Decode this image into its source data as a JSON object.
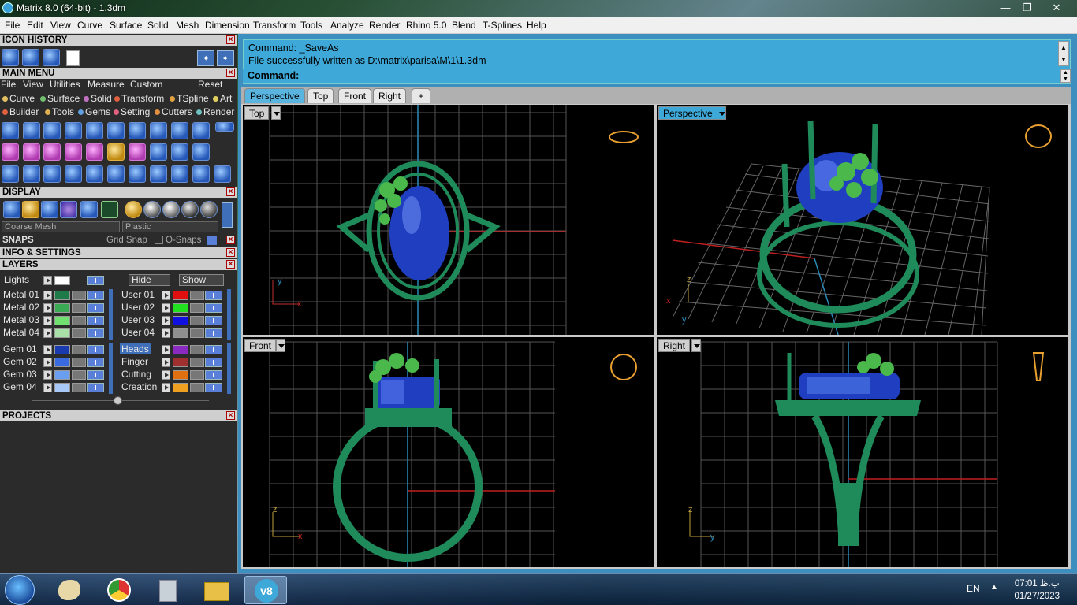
{
  "window": {
    "title": "Matrix 8.0 (64-bit) - 1.3dm"
  },
  "menubar": [
    "File",
    "Edit",
    "View",
    "Curve",
    "Surface",
    "Solid",
    "Mesh",
    "Dimension",
    "Transform",
    "Tools",
    "Analyze",
    "Render",
    "Rhino 5.0",
    "Blend",
    "T-Splines",
    "Help"
  ],
  "leftpanel": {
    "icon_history": "ICON HISTORY",
    "main_menu": "MAIN MENU",
    "main_menu_items": [
      "File",
      "View",
      "Utilities",
      "Measure",
      "Custom"
    ],
    "reset": "Reset",
    "categories_row1": [
      "Curve",
      "Surface",
      "Solid",
      "Transform",
      "TSpline",
      "Art"
    ],
    "categories_row2": [
      "Builder",
      "Tools",
      "Gems",
      "Setting",
      "Cutters",
      "Render"
    ],
    "display": "DISPLAY",
    "mesh_mode": "Coarse Mesh",
    "material_mode": "Plastic",
    "snaps": "SNAPS",
    "grid_snap": "Grid Snap",
    "osnaps": "O-Snaps",
    "info_settings": "INFO & SETTINGS",
    "layers": "LAYERS",
    "lights": "Lights",
    "hide": "Hide",
    "show": "Show",
    "layers_left": [
      "Metal 01",
      "Metal 02",
      "Metal 03",
      "Metal 04",
      "Gem 01",
      "Gem 02",
      "Gem 03",
      "Gem 04"
    ],
    "layers_right": [
      "User 01",
      "User 02",
      "User 03",
      "User 04",
      "Heads",
      "Finger",
      "Cutting",
      "Creation"
    ],
    "projects": "PROJECTS"
  },
  "command": {
    "line1": "Command: _SaveAs",
    "line2": "File successfully written as D:\\matrix\\parisa\\M\\1\\1.3dm",
    "prompt": "Command:"
  },
  "tabs": [
    "Perspective",
    "Top",
    "Front",
    "Right"
  ],
  "viewports": {
    "top": "Top",
    "perspective": "Perspective",
    "front": "Front",
    "right": "Right"
  },
  "axes": {
    "x": "x",
    "y": "y",
    "z": "z"
  },
  "taskbar": {
    "lang": "EN",
    "time": "07:01 ب.ظ",
    "date": "01/27/2023"
  },
  "colors": {
    "accent": "#3ea9d8",
    "ring_green": "#2f9a6a",
    "gem_blue": "#1f3fc0"
  }
}
